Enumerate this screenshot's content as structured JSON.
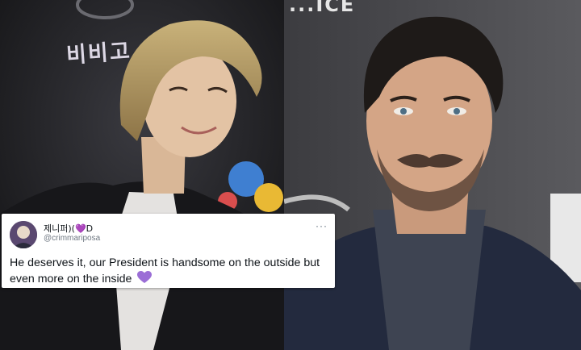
{
  "left_photo": {
    "backdrop_text": "비비고"
  },
  "right_photo": {
    "backdrop_text": "...ICE"
  },
  "tweet": {
    "display_name": "제니퍼)(💜D",
    "handle": "@crimmariposa",
    "more_icon": "more-options-icon",
    "text": "He deserves it, our President is handsome on the outside but even more on the inside",
    "emoji": "purple-heart",
    "heart_color": "#9b6ed6"
  }
}
